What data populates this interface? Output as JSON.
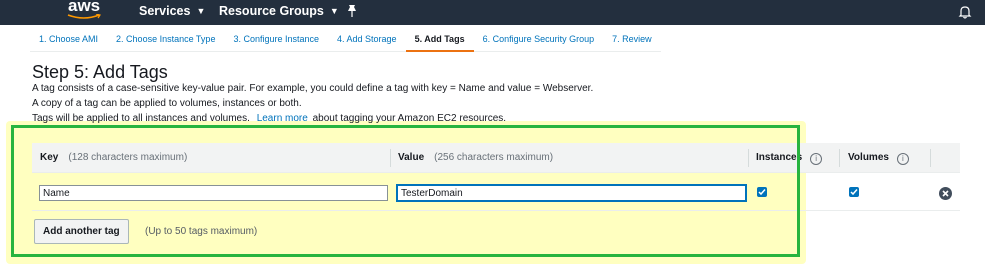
{
  "nav": {
    "logo": "aws",
    "services": "Services",
    "resource_groups": "Resource Groups",
    "caret": "⌄"
  },
  "tabs": [
    {
      "label": "1. Choose AMI"
    },
    {
      "label": "2. Choose Instance Type"
    },
    {
      "label": "3. Configure Instance"
    },
    {
      "label": "4. Add Storage"
    },
    {
      "label": "5. Add Tags"
    },
    {
      "label": "6. Configure Security Group"
    },
    {
      "label": "7. Review"
    }
  ],
  "page": {
    "title": "Step 5: Add Tags",
    "desc1": "A tag consists of a case-sensitive key-value pair. For example, you could define a tag with key = Name and value = Webserver.",
    "desc2": "A copy of a tag can be applied to volumes, instances or both.",
    "desc3_pre": "Tags will be applied to all instances and volumes.",
    "desc3_link": "Learn more",
    "desc3_post": "about tagging your Amazon EC2 resources."
  },
  "table": {
    "key_header": "Key",
    "key_hint": "(128 characters maximum)",
    "value_header": "Value",
    "value_hint": "(256 characters maximum)",
    "instances_header": "Instances",
    "volumes_header": "Volumes",
    "info_glyph": "i",
    "rows": [
      {
        "key": "Name",
        "value": "TesterDomain",
        "instances": true,
        "volumes": true
      }
    ]
  },
  "actions": {
    "add_tag": "Add another tag",
    "add_tag_hint": "(Up to 50 tags maximum)"
  },
  "colors": {
    "nav_bg": "#232f3e",
    "link": "#0073bb",
    "active_tab": "#ec7211",
    "highlight_green": "#27b43f",
    "highlight_yellow": "#ffff8c"
  }
}
